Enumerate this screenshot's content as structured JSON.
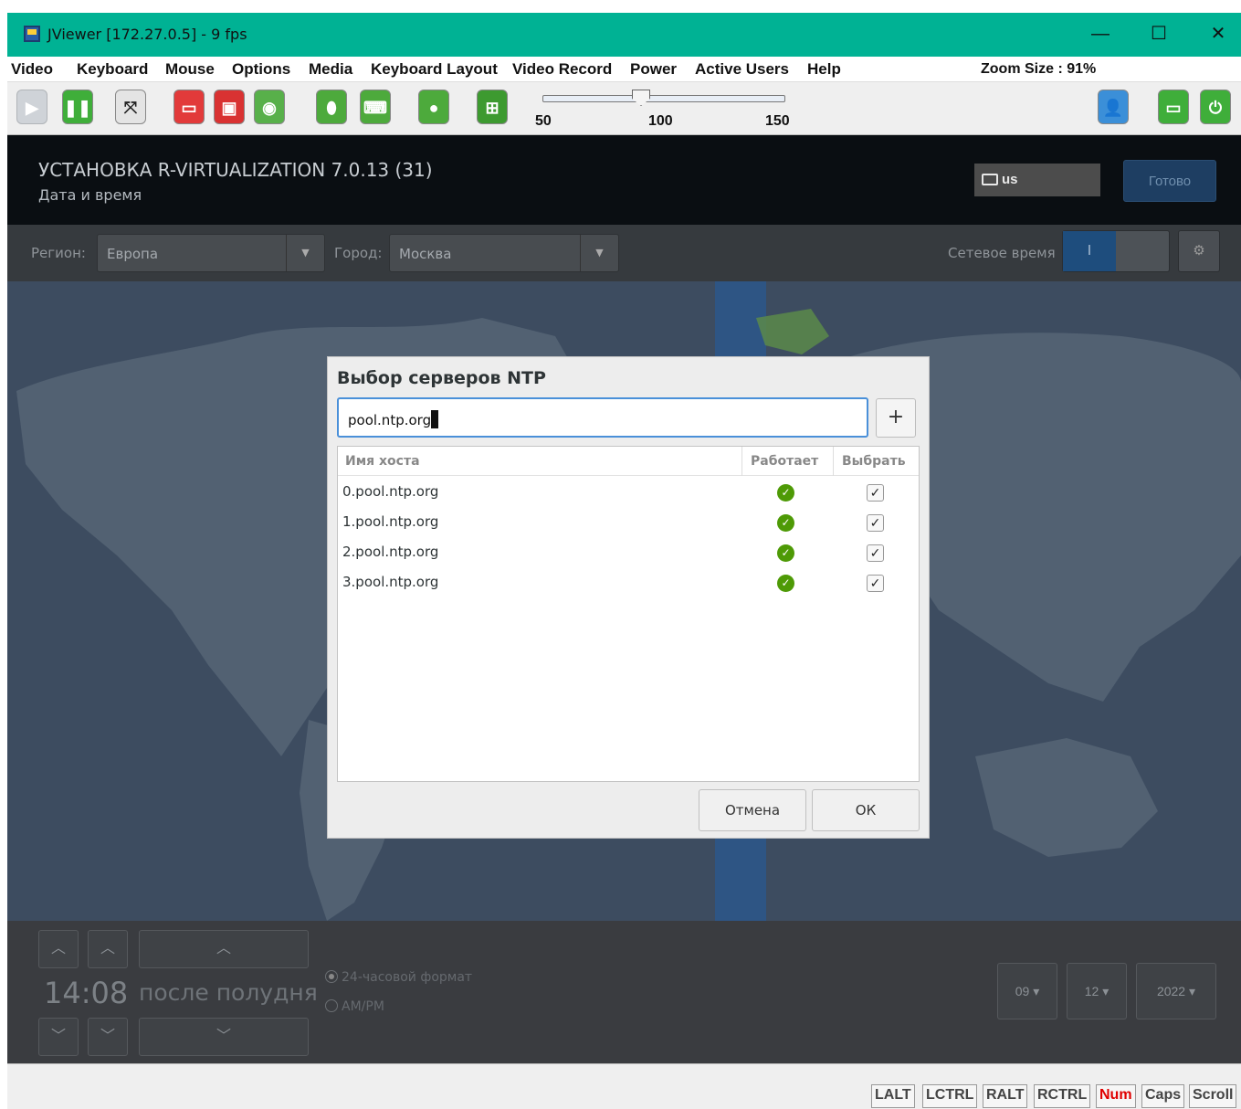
{
  "window": {
    "title": "JViewer [172.27.0.5] - 9 fps",
    "controls": {
      "minimize": "—",
      "maximize": "☐",
      "close": "✕"
    }
  },
  "menubar": {
    "items": [
      {
        "label": "Video",
        "mnemonic": "V"
      },
      {
        "label": "Keyboard",
        "mnemonic": "K"
      },
      {
        "label": "Mouse",
        "mnemonic": "u"
      },
      {
        "label": "Options",
        "mnemonic": "O"
      },
      {
        "label": "Media",
        "mnemonic": "d"
      },
      {
        "label": "Keyboard Layout",
        "mnemonic": "L"
      },
      {
        "label": "Video Record",
        "mnemonic": "i"
      },
      {
        "label": "Power",
        "mnemonic": "w"
      },
      {
        "label": "Active Users",
        "mnemonic": "A"
      },
      {
        "label": "Help",
        "mnemonic": "H"
      }
    ],
    "zoom_size": "Zoom Size : 91%"
  },
  "toolbar": {
    "zoom_slider": {
      "min_label": "50",
      "mid_label": "100",
      "max_label": "150",
      "value": 91
    },
    "icons": [
      "play-icon",
      "pause-icon",
      "fullscreen-icon",
      "stop-recording-icon",
      "save-icon",
      "cd-icon",
      "mouse-icon",
      "keyboard-icon",
      "video-record-icon",
      "soft-keyboard-icon",
      "user-icon",
      "monitor-icon",
      "power-icon"
    ]
  },
  "installer": {
    "title": "УСТАНОВКА R-VIRTUALIZATION 7.0.13 (31)",
    "subtitle": "Дата и время",
    "keyboard_layout": "us",
    "done_button": "Готово",
    "region_label": "Регион:",
    "region_value": "Европа",
    "city_label": "Город:",
    "city_value": "Москва",
    "network_time_label": "Сетевое время",
    "network_time_toggle": "I",
    "time": {
      "hours_minutes": "14:08",
      "period": "после полудня",
      "format_24": "24-часовой формат",
      "format_ampm": "AM/PM"
    },
    "date": {
      "day": "09",
      "month": "12",
      "year": "2022"
    }
  },
  "dialog": {
    "title": "Выбор серверов NTP",
    "input_value": "pool.ntp.org",
    "add_button": "+",
    "columns": {
      "host": "Имя хоста",
      "working": "Работает",
      "select": "Выбрать"
    },
    "servers": [
      {
        "host": "0.pool.ntp.org",
        "working": true,
        "selected": true
      },
      {
        "host": "1.pool.ntp.org",
        "working": true,
        "selected": true
      },
      {
        "host": "2.pool.ntp.org",
        "working": true,
        "selected": true
      },
      {
        "host": "3.pool.ntp.org",
        "working": true,
        "selected": true
      }
    ],
    "cancel_button": "Отмена",
    "ok_button": "ОК"
  },
  "statusbar": {
    "keys": [
      "LALT",
      "LCTRL",
      "RALT",
      "RCTRL",
      "Num",
      "Caps",
      "Scroll"
    ],
    "active_key": "Num",
    "active_color": "#e00000"
  },
  "colors": {
    "titlebar": "#00b294",
    "accent_blue": "#4a90d9",
    "ok_green": "#4e9a06"
  }
}
